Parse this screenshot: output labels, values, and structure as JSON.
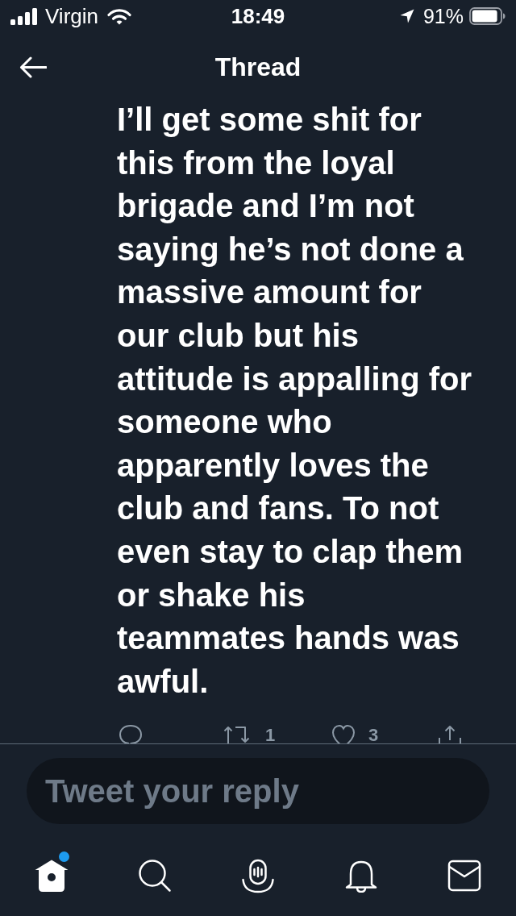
{
  "status_bar": {
    "carrier": "Virgin",
    "time": "18:49",
    "battery": "91%"
  },
  "header": {
    "title": "Thread"
  },
  "tweet": {
    "text": "I’ll get some shit for this from the loyal brigade and I’m not saying he’s not done a massive amount for our club but his attitude is appalling for someone who apparently loves the club and fans. To not even stay to clap them or shake his teammates hands was awful.",
    "actions": [
      {
        "kind": "reply"
      },
      {
        "kind": "retweet",
        "count": "1"
      },
      {
        "kind": "like",
        "count": "3"
      },
      {
        "kind": "share"
      }
    ]
  },
  "composer": {
    "placeholder": "Tweet your reply"
  },
  "tab_bar": {
    "items": [
      {
        "kind": "home",
        "selected": true,
        "badge": true
      },
      {
        "kind": "search",
        "selected": false,
        "badge": false
      },
      {
        "kind": "spaces",
        "selected": false,
        "badge": false
      },
      {
        "kind": "notifications",
        "selected": false,
        "badge": false
      },
      {
        "kind": "messages",
        "selected": false,
        "badge": false
      }
    ]
  }
}
